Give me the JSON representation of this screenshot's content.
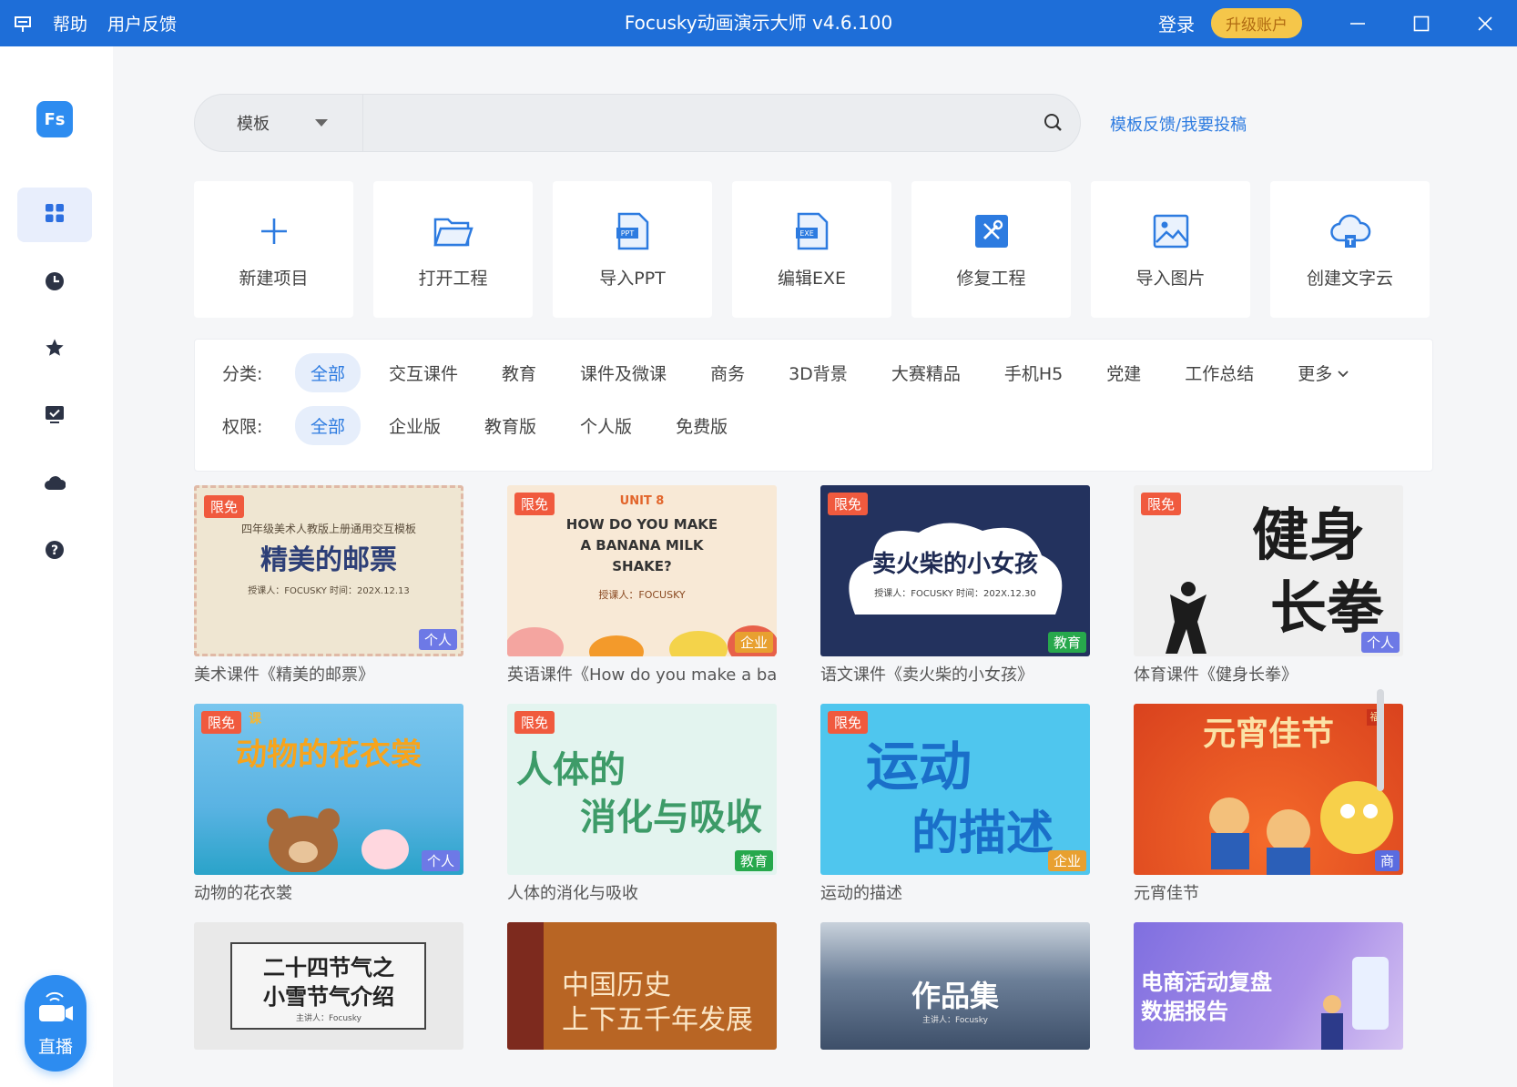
{
  "titlebar": {
    "menu_help": "帮助",
    "menu_feedback": "用户反馈",
    "title": "Focusky动画演示大师 v4.6.100",
    "login": "登录",
    "upgrade": "升级账户"
  },
  "sidebar": {
    "logo_text": "Fs",
    "items": [
      {
        "name": "grid-icon",
        "active": true
      },
      {
        "name": "clock-icon"
      },
      {
        "name": "star-icon"
      },
      {
        "name": "monitor-check-icon"
      },
      {
        "name": "cloud-icon"
      },
      {
        "name": "help-icon"
      }
    ],
    "live_badge": "live",
    "live_label": "直播"
  },
  "search": {
    "type_label": "模板",
    "value": "",
    "placeholder": ""
  },
  "template_feedback": "模板反馈/我要投稿",
  "actions": [
    {
      "label": "新建项目",
      "icon": "plus-icon"
    },
    {
      "label": "打开工程",
      "icon": "folder-open-icon"
    },
    {
      "label": "导入PPT",
      "icon": "ppt-file-icon"
    },
    {
      "label": "编辑EXE",
      "icon": "exe-file-icon"
    },
    {
      "label": "修复工程",
      "icon": "repair-tools-icon"
    },
    {
      "label": "导入图片",
      "icon": "image-icon"
    },
    {
      "label": "创建文字云",
      "icon": "text-cloud-icon"
    }
  ],
  "filters": {
    "category_label": "分类:",
    "categories": [
      "全部",
      "交互课件",
      "教育",
      "课件及微课",
      "商务",
      "3D背景",
      "大赛精品",
      "手机H5",
      "党建",
      "工作总结"
    ],
    "more": "更多",
    "permission_label": "权限:",
    "permissions": [
      "全部",
      "企业版",
      "教育版",
      "个人版",
      "免费版"
    ]
  },
  "badges": {
    "free": "限免",
    "personal": "个人",
    "enterprise": "企业",
    "education": "教育",
    "business": "商"
  },
  "templates": [
    {
      "title": "美术课件《精美的邮票》",
      "free": true,
      "type": "personal",
      "bg": "#efe6d2",
      "lines": [
        "四年级美术人教版上册通用交互模板",
        "精美的邮票",
        "授课人：FOCUSKY   时间：202X.12.13"
      ]
    },
    {
      "title": "英语课件《How do you make a banana milk shake?》",
      "free": true,
      "type": "enterprise",
      "bg": "#f8e9d6",
      "lines": [
        "UNIT 8",
        "HOW DO YOU MAKE",
        "A BANANA MILK",
        "SHAKE?",
        "授课人：FOCUSKY"
      ]
    },
    {
      "title": "语文课件《卖火柴的小女孩》",
      "free": true,
      "type": "education",
      "bg": "#23325e",
      "lines": [
        "卖火柴的小女孩",
        "授课人：FOCUSKY    时间：202X.12.30"
      ]
    },
    {
      "title": "体育课件《健身长拳》",
      "free": true,
      "type": "personal",
      "bg": "#efefef",
      "lines": [
        "健身",
        "长拳"
      ]
    },
    {
      "title": "动物的花衣裳",
      "free": true,
      "type": "personal",
      "bg": "#66bce8",
      "lines": [
        "课",
        "动物的花衣裳"
      ]
    },
    {
      "title": "人体的消化与吸收",
      "free": true,
      "type": "education",
      "bg": "#e3f4ef",
      "lines": [
        "人体的",
        "消化与吸收"
      ]
    },
    {
      "title": "运动的描述",
      "free": true,
      "type": "enterprise",
      "bg": "#4fc6ee",
      "lines": [
        "运动",
        "的描述"
      ]
    },
    {
      "title": "元宵佳节",
      "free": false,
      "type": "business",
      "bg": "#e8562c",
      "lines": [
        "元宵佳节",
        "福"
      ]
    },
    {
      "title": "",
      "free": false,
      "type": "",
      "bg": "#e9e9e9",
      "lines": [
        "二十四节气之",
        "小雪节气介绍",
        "主讲人：Focusky"
      ]
    },
    {
      "title": "",
      "free": false,
      "type": "",
      "bg": "#b86524",
      "lines": [
        "中国历史",
        "上下五千年发展"
      ]
    },
    {
      "title": "",
      "free": false,
      "type": "",
      "bg": "#4a5f7e",
      "lines": [
        "作品集",
        "主讲人：Focusky"
      ]
    },
    {
      "title": "",
      "free": false,
      "type": "",
      "bg": "#9a86e0",
      "lines": [
        "电商活动复盘",
        "数据报告"
      ]
    }
  ]
}
